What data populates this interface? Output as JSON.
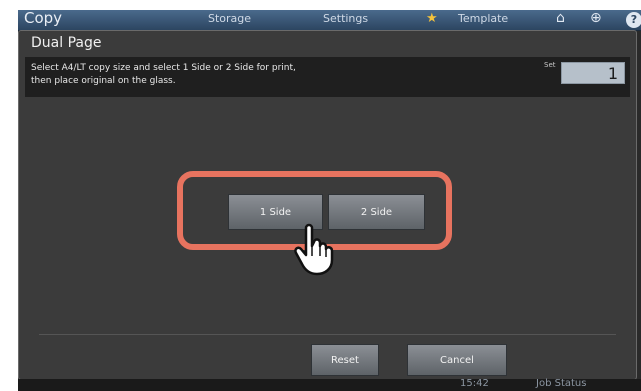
{
  "topbar": {
    "title": "Copy",
    "storage": "Storage",
    "settings": "Settings",
    "template": "Template",
    "help": "?"
  },
  "dialog": {
    "title": "Dual Page",
    "message_line1": "Select A4/LT copy size and select 1 Side or 2 Side for print,",
    "message_line2": "then place original on the glass.",
    "set_label": "Set",
    "set_value": "1"
  },
  "buttons": {
    "one_side": "1 Side",
    "two_side": "2 Side",
    "reset": "Reset",
    "cancel": "Cancel"
  },
  "statusbar": {
    "time": "15:42",
    "job_status": "Job Status"
  },
  "colors": {
    "highlight": "#e7735f",
    "topbar": "#2c4561"
  },
  "icons": [
    "star-icon",
    "home-icon",
    "globe-icon",
    "help-icon",
    "pointing-hand-icon"
  ]
}
